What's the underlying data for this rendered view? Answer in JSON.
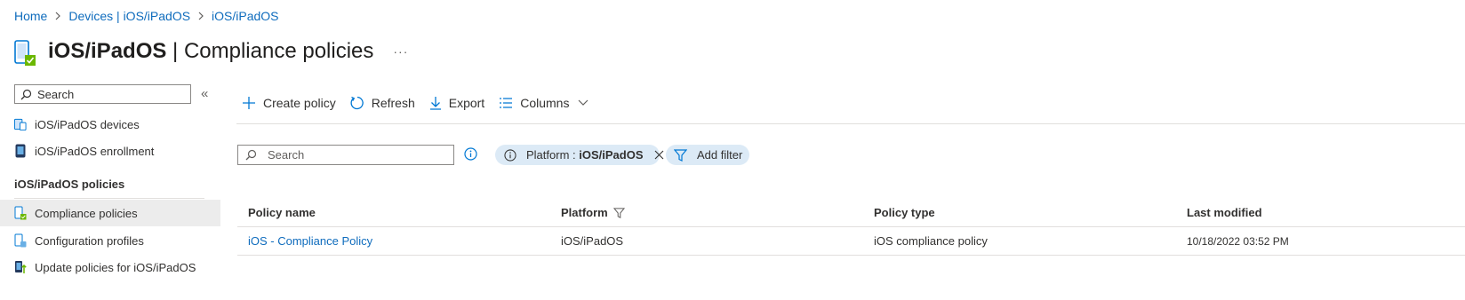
{
  "breadcrumb": {
    "items": [
      "Home",
      "Devices | iOS/iPadOS",
      "iOS/iPadOS"
    ]
  },
  "header": {
    "title_bold": "iOS/iPadOS",
    "title_rest": " | Compliance policies",
    "more": "···"
  },
  "sidebar": {
    "search_placeholder": "Search",
    "collapse": "«",
    "items": [
      {
        "label": "iOS/iPadOS devices",
        "icon": "devices-icon"
      },
      {
        "label": "iOS/iPadOS enrollment",
        "icon": "enrollment-icon"
      }
    ],
    "section_title": "iOS/iPadOS policies",
    "section_items": [
      {
        "label": "Compliance policies",
        "icon": "compliance-icon",
        "selected": true
      },
      {
        "label": "Configuration profiles",
        "icon": "configuration-icon"
      },
      {
        "label": "Update policies for iOS/iPadOS",
        "icon": "update-icon"
      }
    ]
  },
  "toolbar": {
    "create": "Create policy",
    "refresh": "Refresh",
    "export": "Export",
    "columns": "Columns"
  },
  "filters": {
    "search_placeholder": "Search",
    "platform_label": "Platform : ",
    "platform_value": "iOS/iPadOS",
    "add_filter": "Add filter"
  },
  "table": {
    "columns": [
      "Policy name",
      "Platform",
      "Policy type",
      "Last modified"
    ],
    "rows": [
      [
        "iOS - Compliance Policy",
        "iOS/iPadOS",
        "iOS compliance policy",
        "10/18/2022 03:52 PM"
      ]
    ]
  },
  "colors": {
    "accent": "#0f6cbd",
    "pill": "#dceaf6",
    "selected": "#ececec",
    "check": "#6bb700"
  }
}
